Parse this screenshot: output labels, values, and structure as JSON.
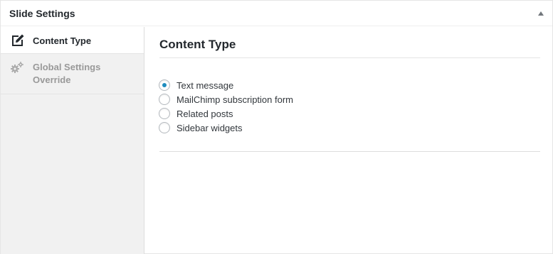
{
  "panel": {
    "title": "Slide Settings"
  },
  "sidebar": {
    "tabs": [
      {
        "label": "Content Type",
        "icon": "edit-icon",
        "active": true
      },
      {
        "label": "Global Settings Override",
        "icon": "gears-icon",
        "active": false
      }
    ]
  },
  "content": {
    "heading": "Content Type",
    "options": [
      {
        "label": "Text message",
        "checked": true
      },
      {
        "label": "MailChimp subscription form",
        "checked": false
      },
      {
        "label": "Related posts",
        "checked": false
      },
      {
        "label": "Sidebar widgets",
        "checked": false
      }
    ]
  },
  "colors": {
    "accent": "#1e8cbe",
    "inactive_text": "#999999"
  }
}
